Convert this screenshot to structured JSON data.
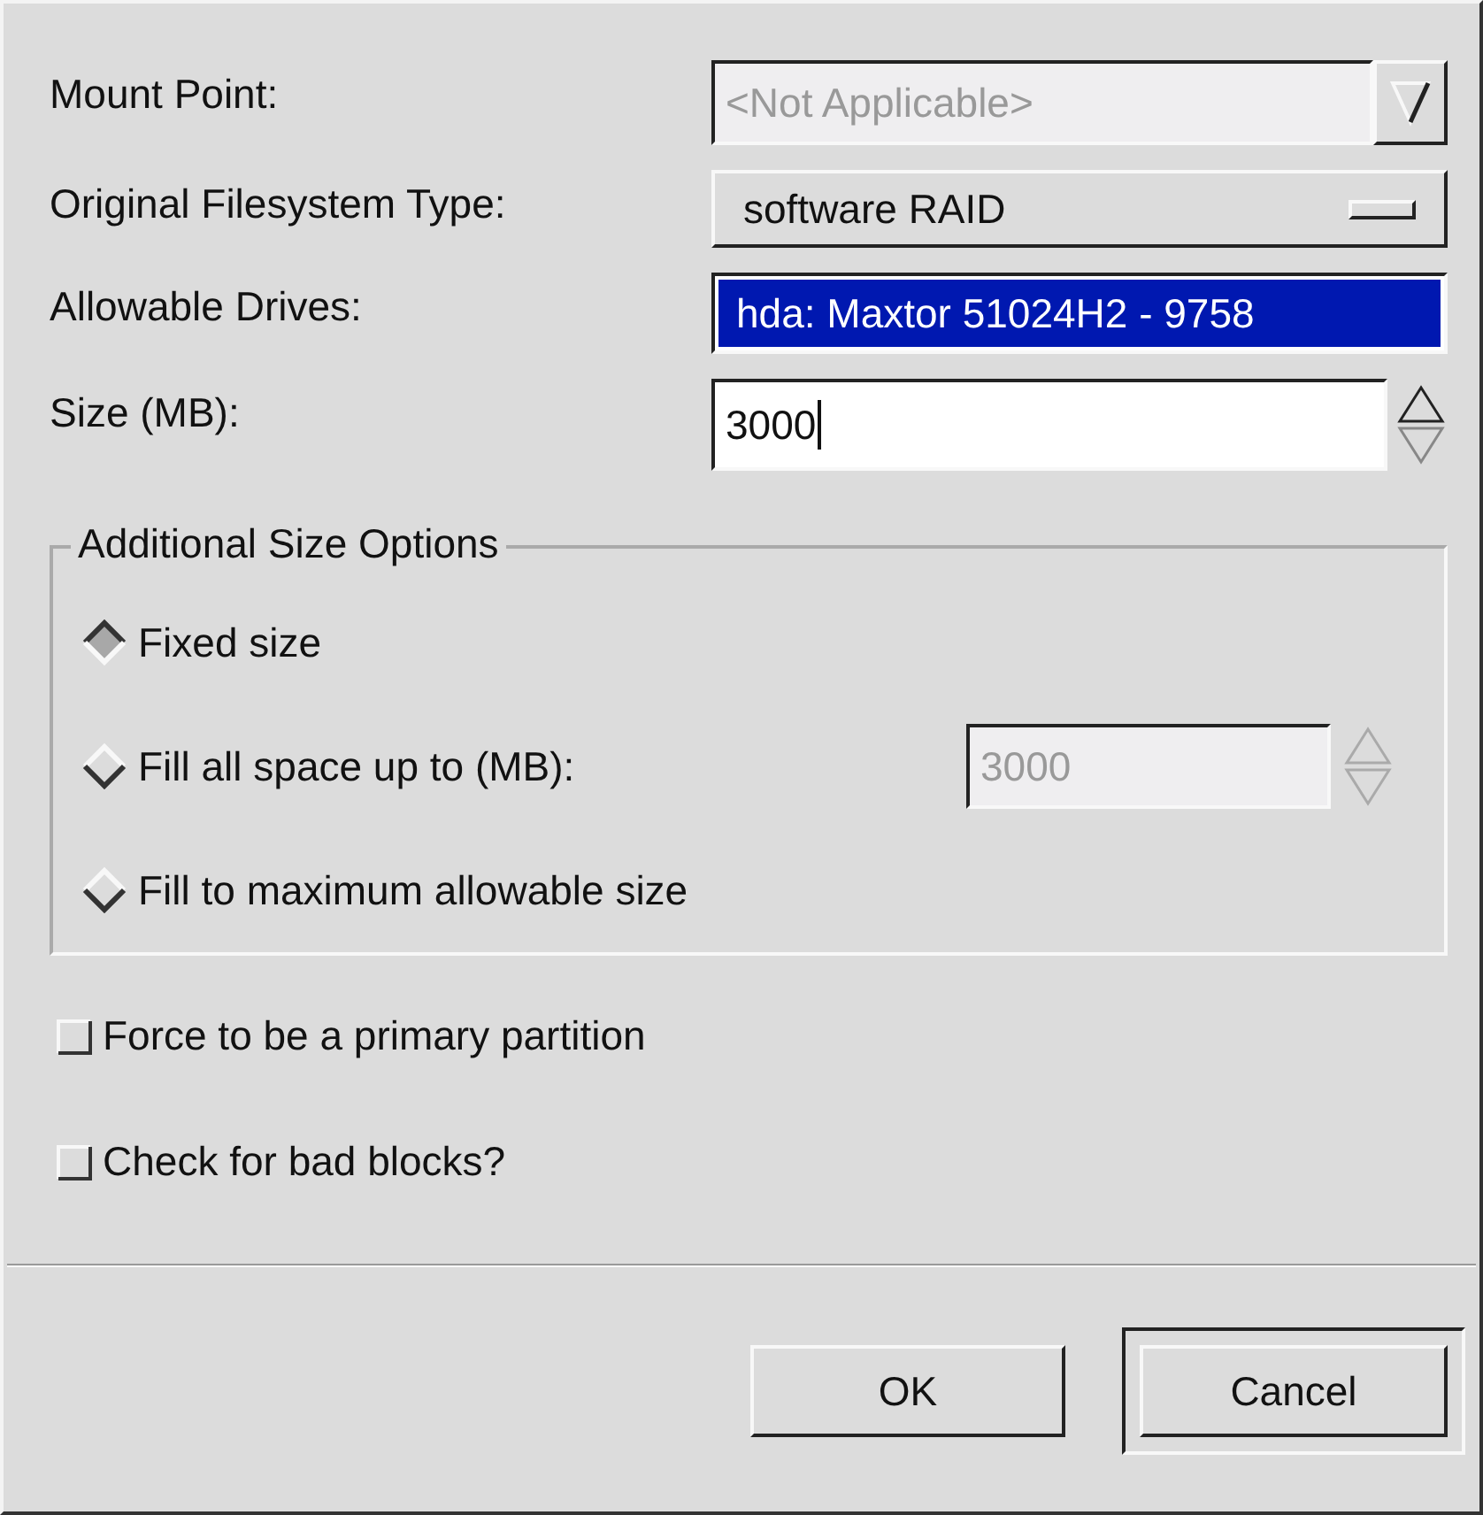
{
  "fields": [
    {
      "kind": "combo",
      "label": "Mount Point:",
      "value": "<Not Applicable>",
      "disabled": true
    },
    {
      "kind": "option_menu",
      "label": "Original Filesystem Type:",
      "value": "software RAID",
      "disabled": false
    },
    {
      "kind": "list",
      "label": "Allowable Drives:",
      "disabled": false,
      "items": [
        {
          "value": "hda: Maxtor 51024H2 - 9758",
          "selected": true
        }
      ]
    },
    {
      "kind": "spin",
      "label": "Size (MB):",
      "value": "3000",
      "disabled": false
    }
  ],
  "size_options": {
    "title": "Additional Size Options",
    "options": [
      {
        "label": "Fixed size",
        "selected": true
      },
      {
        "label": "Fill all space up to (MB):",
        "selected": false,
        "spin": {
          "value": "3000",
          "disabled": true
        }
      },
      {
        "label": "Fill to maximum allowable size",
        "selected": false
      }
    ]
  },
  "checkboxes": [
    {
      "label": "Force to be a primary partition",
      "checked": false
    },
    {
      "label": "Check for bad blocks?",
      "checked": false
    }
  ],
  "buttons": [
    {
      "label": "OK",
      "default": false
    },
    {
      "label": "Cancel",
      "default": true
    }
  ]
}
